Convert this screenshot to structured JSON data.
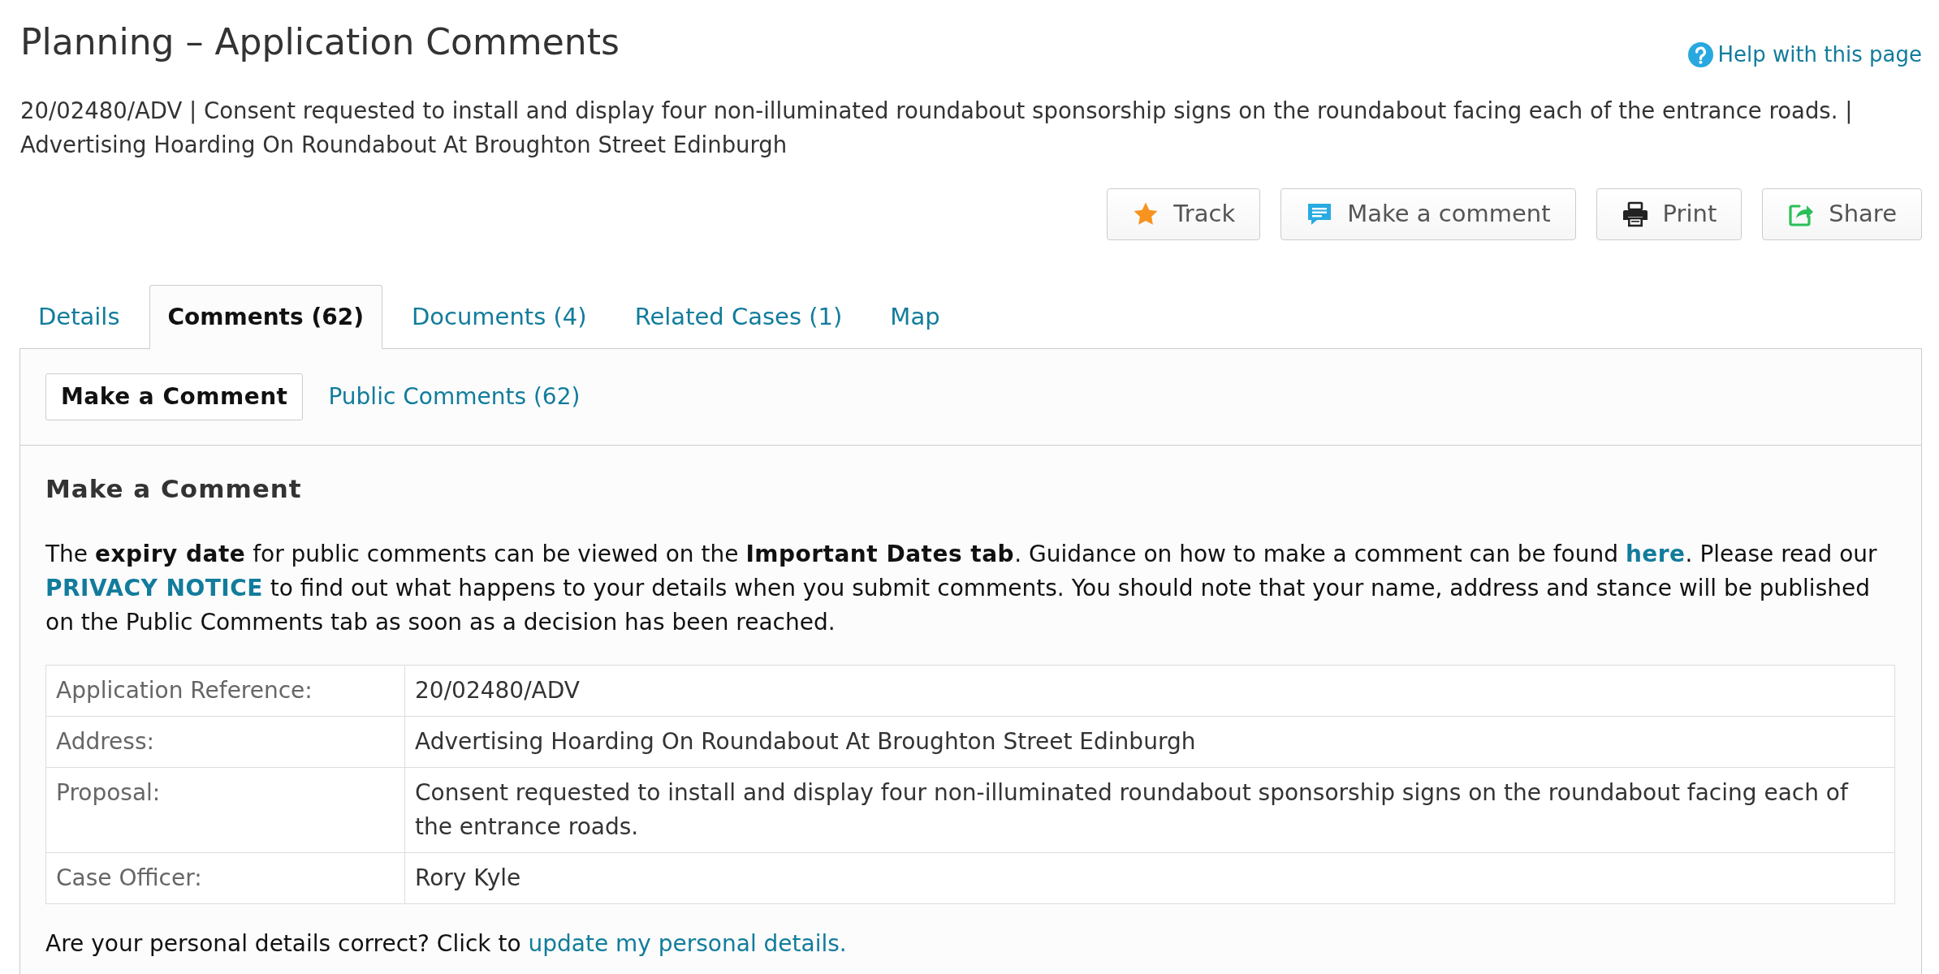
{
  "page": {
    "title": "Planning – Application Comments",
    "help_link": "Help with this page"
  },
  "summary": "20/02480/ADV | Consent requested to install and display four non-illuminated roundabout sponsorship signs on the roundabout facing each of the entrance roads. | Advertising Hoarding On Roundabout At Broughton Street Edinburgh",
  "actions": [
    {
      "kind": "track",
      "label": "Track"
    },
    {
      "kind": "comment",
      "label": "Make a comment"
    },
    {
      "kind": "print",
      "label": "Print"
    },
    {
      "kind": "share",
      "label": "Share"
    }
  ],
  "tabs": [
    {
      "label": "Details",
      "selected": false
    },
    {
      "label": "Comments (62)",
      "selected": true
    },
    {
      "label": "Documents (4)",
      "selected": false
    },
    {
      "label": "Related Cases (1)",
      "selected": false
    },
    {
      "label": "Map",
      "selected": false
    }
  ],
  "subtabs": [
    {
      "label": "Make a Comment",
      "selected": true
    },
    {
      "label": "Public Comments (62)",
      "selected": false
    }
  ],
  "section": {
    "heading": "Make a Comment",
    "intro": [
      {
        "kind": "text",
        "text": "The **expiry date** for public comments can be viewed on the **Important Dates tab**. Guidance on how to make a comment can be found "
      },
      {
        "kind": "link",
        "text": "here"
      },
      {
        "kind": "text",
        "text": ". Please read our "
      },
      {
        "kind": "link",
        "text": "PRIVACY NOTICE"
      },
      {
        "kind": "text",
        "text": " to find out what happens to your details when you submit comments. You should note that your name, address and stance will be published on the Public Comments tab as soon as a decision has been reached."
      }
    ]
  },
  "details_table": {
    "rows": [
      {
        "label": "Application Reference:",
        "value": "20/02480/ADV"
      },
      {
        "label": "Address:",
        "value": "Advertising Hoarding On Roundabout At Broughton Street Edinburgh"
      },
      {
        "label": "Proposal:",
        "value": "Consent requested to install and display four non-illuminated roundabout sponsorship signs on the roundabout facing each of the entrance roads."
      },
      {
        "label": "Case Officer:",
        "value": "Rory Kyle"
      }
    ]
  },
  "personal_details": {
    "text": "Are your personal details correct? Click to",
    "link": "update my personal details."
  }
}
